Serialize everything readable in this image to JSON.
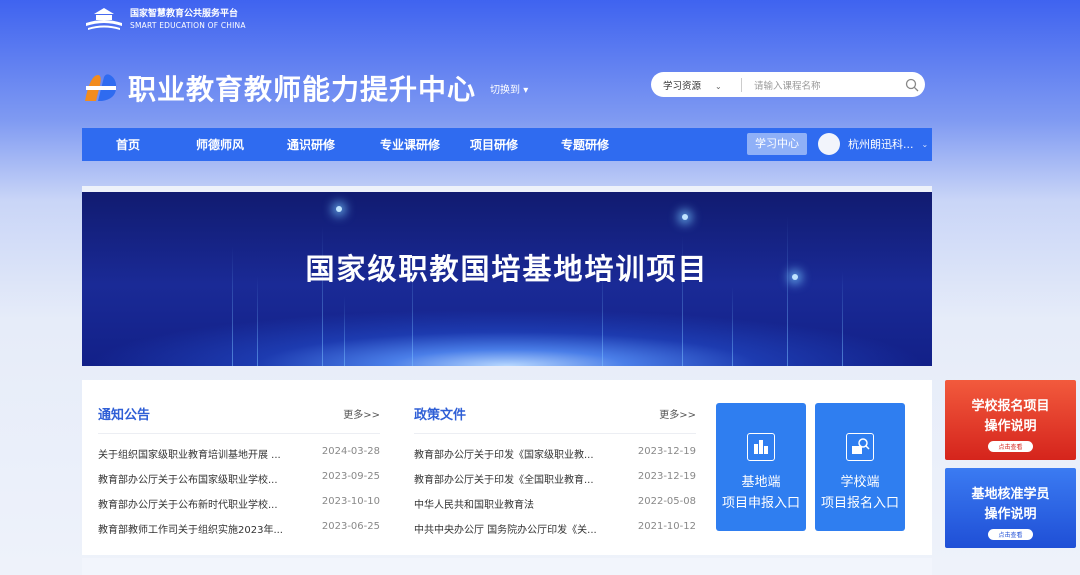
{
  "platform": {
    "name_cn": "国家智慧教育公共服务平台",
    "name_en": "SMART EDUCATION OF CHINA"
  },
  "brand": {
    "title": "职业教育教师能力提升中心",
    "switch_label": "切换到"
  },
  "search": {
    "scope": "学习资源",
    "placeholder": "请输入课程名称"
  },
  "nav": {
    "items": [
      "首页",
      "师德师风",
      "通识研修",
      "专业课研修",
      "项目研修",
      "专题研修"
    ],
    "study_center": "学习中心",
    "user_name": "杭州朗迅科..."
  },
  "banner": {
    "title": "国家级职教国培基地培训项目"
  },
  "notices": {
    "title": "通知公告",
    "more": "更多>>",
    "rows": [
      {
        "title": "关于组织国家级职业教育培训基地开展 ...",
        "date": "2024-03-28"
      },
      {
        "title": "教育部办公厅关于公布国家级职业学校...",
        "date": "2023-09-25"
      },
      {
        "title": "教育部办公厅关于公布新时代职业学校...",
        "date": "2023-10-10"
      },
      {
        "title": "教育部教师工作司关于组织实施2023年...",
        "date": "2023-06-25"
      }
    ]
  },
  "policies": {
    "title": "政策文件",
    "more": "更多>>",
    "rows": [
      {
        "title": "教育部办公厅关于印发《国家级职业教...",
        "date": "2023-12-19"
      },
      {
        "title": "教育部办公厅关于印发《全国职业教育...",
        "date": "2023-12-19"
      },
      {
        "title": "中华人民共和国职业教育法",
        "date": "2022-05-08"
      },
      {
        "title": "中共中央办公厅 国务院办公厅印发《关...",
        "date": "2021-10-12"
      }
    ]
  },
  "entries": [
    {
      "line1": "基地端",
      "line2": "项目申报入口"
    },
    {
      "line1": "学校端",
      "line2": "项目报名入口"
    }
  ],
  "side_cards": [
    {
      "line1": "学校报名项目",
      "line2": "操作说明",
      "button": "点击查看",
      "color": "#e8402d"
    },
    {
      "line1": "基地核准学员",
      "line2": "操作说明",
      "button": "点击查看",
      "color": "#2b68e8"
    }
  ],
  "colors": {
    "accent": "#2f6bf0",
    "heading": "#2f5fd6",
    "entry": "#2f7ef0"
  }
}
